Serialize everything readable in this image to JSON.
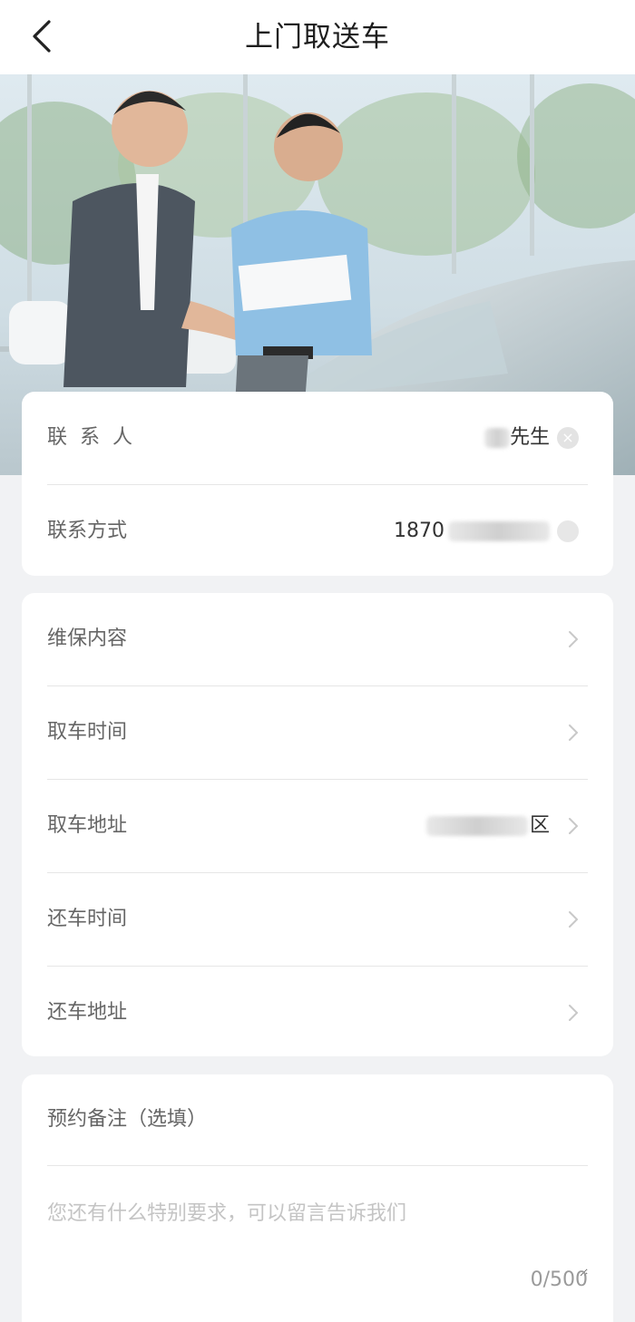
{
  "nav": {
    "back_icon": "chevron-left-icon",
    "title": "上门取送车"
  },
  "banner": {
    "alt": ""
  },
  "contact": {
    "name_label": "联系人",
    "name_value": "先生",
    "phone_label": "联系方式",
    "phone_value": "1870"
  },
  "service": {
    "items": [
      {
        "label": "维保内容",
        "value": ""
      },
      {
        "label": "取车时间",
        "value": ""
      },
      {
        "label": "取车地址",
        "value": "区"
      },
      {
        "label": "还车时间",
        "value": ""
      },
      {
        "label": "还车地址",
        "value": ""
      }
    ]
  },
  "remark": {
    "label": "预约备注（选填）",
    "placeholder": "您还有什么特别要求，可以留言告诉我们",
    "counter": "0/500"
  },
  "colors": {
    "background": "#f1f2f4",
    "card": "#ffffff",
    "label": "#666666",
    "placeholder": "#c4c4c4"
  }
}
